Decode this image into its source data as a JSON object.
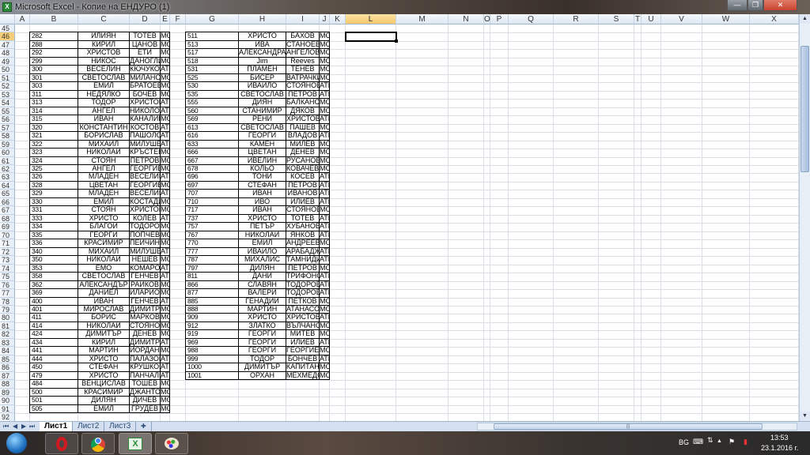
{
  "window": {
    "title": "Microsoft Excel - Копие на ЕНДУРО (1)",
    "minimize": "—",
    "restore": "❐",
    "close": "✕"
  },
  "columns": [
    "A",
    "B",
    "C",
    "D",
    "E",
    "F",
    "G",
    "H",
    "I",
    "J",
    "K",
    "L",
    "M",
    "N",
    "O",
    "P",
    "Q",
    "R",
    "S",
    "T",
    "U",
    "V",
    "W",
    "X"
  ],
  "selected_column": "L",
  "selected_row": "46",
  "rows": [
    "45",
    "46",
    "47",
    "48",
    "49",
    "50",
    "51",
    "52",
    "53",
    "54",
    "55",
    "56",
    "57",
    "58",
    "59",
    "60",
    "61",
    "62",
    "63",
    "64",
    "65",
    "66",
    "67",
    "68",
    "69",
    "70",
    "71",
    "72",
    "73",
    "74",
    "75",
    "76",
    "77",
    "78",
    "79",
    "80",
    "81",
    "82",
    "83",
    "84",
    "85",
    "86",
    "87",
    "88",
    "89",
    "90",
    "91",
    "92"
  ],
  "left_table": [
    [
      "282",
      "ИЛИЯН",
      "ТОТЕВ",
      "МОТОРИ"
    ],
    [
      "288",
      "КИРИЛ",
      "ЦАНОВ",
      "МОТОРИ"
    ],
    [
      "292",
      "ХРИСТОВ",
      "ЕТИ",
      "МОТОРИ"
    ],
    [
      "299",
      "НИКОС",
      "ДАНОГЛИДИС",
      "МОТОРИ"
    ],
    [
      "300",
      "ВЕСЕЛИН",
      "КЮЧУКОВ",
      "АТВ"
    ],
    [
      "301",
      "СВЕТОСЛАВ",
      "МИЛАНОВ",
      "МОТОРИ"
    ],
    [
      "303",
      "ЕМИЛ",
      "БРАТОЕВ",
      "МОТОРИ"
    ],
    [
      "311",
      "НЕДЯЛКО",
      "БОЧЕВ",
      "МОТОРИ"
    ],
    [
      "313",
      "ТОДОР",
      "ХРИСТОВ",
      "АТВ"
    ],
    [
      "314",
      "АНГЕЛ",
      "НИКОЛОВ",
      "АТВ"
    ],
    [
      "315",
      "ИВАН",
      "КАНАЛИЕВ",
      "МОТОРИ"
    ],
    [
      "320",
      "КОНСТАНТИН",
      "КОСТОВ",
      "АТВ"
    ],
    [
      "321",
      "БОРИСЛАВ",
      "ПАШОЛОВ",
      "АТВ"
    ],
    [
      "322",
      "МИХАИЛ",
      "МИЛУШЕВ",
      "АТВ"
    ],
    [
      "323",
      "НИКОЛАЙ",
      "КРЪСТЕВ",
      "МОТОРИ"
    ],
    [
      "324",
      "СТОЯН",
      "ПЕТРОВ",
      "МОТОРИ"
    ],
    [
      "325",
      "АНГЕЛ",
      "ГЕОРГИЕВ",
      "МОТОРИ"
    ],
    [
      "326",
      "МЛАДЕН",
      "ВЕСЕЛИНОВ",
      "АТВ"
    ],
    [
      "328",
      "ЦВЕТАН",
      "ГЕОРГИЕВ",
      "МОТОРИ"
    ],
    [
      "329",
      "МЛАДЕН",
      "ВЕСЕЛИНОВ",
      "АТВ"
    ],
    [
      "330",
      "ЕМИЛ",
      "КОСТАДИНОВ",
      "МОТОРИ"
    ],
    [
      "331",
      "СТОЯН",
      "ХРИСТОВ",
      "МОТОРИ"
    ],
    [
      "333",
      "ХРИСТО",
      "КОЛЕВ",
      "АТВ"
    ],
    [
      "334",
      "БЛАГОЙ",
      "ТОДОРОВ",
      "МОТОРИ"
    ],
    [
      "335",
      "ГЕОРГИ",
      "ПОПЧЕВ",
      "МОТОРИ"
    ],
    [
      "336",
      "КРАСИМИР",
      "ПЕЙЧИНОВ",
      "МОТОРИ"
    ],
    [
      "340",
      "МИХАИЛ",
      "МИЛУШЕВ",
      "АТВ"
    ],
    [
      "350",
      "НИКОЛАЙ",
      "НЕШЕВ",
      "МОТОРИ"
    ],
    [
      "353",
      "ЕМО",
      "КОМАРОВСКИ",
      "АТВ"
    ],
    [
      "358",
      "СВЕТОСЛАВ",
      "ГЕНЧЕВ",
      "АТВ"
    ],
    [
      "362",
      "АЛЕКСАНДЪР",
      "РАЙКОВ",
      "МОТОРИ"
    ],
    [
      "369",
      "ДАНИЕЛ",
      "ИЛАРИОНОВ",
      "МОТОРИ"
    ],
    [
      "400",
      "ИВАН",
      "ГЕНЧЕВ",
      "АТВ"
    ],
    [
      "401",
      "МИРОСЛАВ",
      "ДИМИТРОВ",
      "МОТОРИ"
    ],
    [
      "411",
      "БОРИС",
      "МАРКОВ",
      "МОТОРИ"
    ],
    [
      "414",
      "НИКОЛАЙ",
      "СТОЯНОВ",
      "МОТОРИ"
    ],
    [
      "424",
      "ДИМИТЪР",
      "ДЕНЕВ",
      "МОТОРИ"
    ],
    [
      "434",
      "КИРИЛ",
      "ДИМИТРОВ",
      "АТВ"
    ],
    [
      "441",
      "МАРТИН",
      "ЙОРДАНОВ",
      "МОТОРИ"
    ],
    [
      "444",
      "ХРИСТО",
      "ПАЛАЗОВ",
      "АТВ"
    ],
    [
      "450",
      "СТЕФАН",
      "КРУШКОВ",
      "АТВ"
    ],
    [
      "479",
      "ХРИСТО",
      "ПАНЧАЛИЕВ",
      "АТВ"
    ],
    [
      "484",
      "ВЕНЦИСЛАВ",
      "ТОШЕВ",
      "МОТОРИ"
    ],
    [
      "500",
      "КРАСИМИР",
      "ДЖАНТОВ",
      "МОТОРИ"
    ],
    [
      "501",
      "ДИЛЯН",
      "ДИЧЕВ",
      "МОТОРИ"
    ],
    [
      "505",
      "ЕМИЛ",
      "ГРУДЕВ",
      "МОТОРИ"
    ]
  ],
  "right_table": [
    [
      "511",
      "ХРИСТО",
      "БАХОВ",
      "МОТОРИ"
    ],
    [
      "513",
      "ИВА",
      "СТАНОЕВА",
      "МОТОРИ"
    ],
    [
      "517",
      "АЛЕКСАНДРА",
      "АНГЕЛОВА",
      "МОТОРИ"
    ],
    [
      "518",
      "Jim",
      "Reeves",
      "МОТОРИ"
    ],
    [
      "531",
      "ПЛАМЕН",
      "ТЕНЕВ",
      "МОТОРИ"
    ],
    [
      "525",
      "БИСЕР",
      "ВАТРАЧКИ",
      "МОТОРИ"
    ],
    [
      "530",
      "ИВАЙЛО",
      "СТОЯНОВ",
      "АТВ"
    ],
    [
      "535",
      "СВЕТОСЛАВ",
      "ПЕТРОВ",
      "АТВ"
    ],
    [
      "555",
      "ДИЯН",
      "БАЛКАНСКИ",
      "МОТОРИ"
    ],
    [
      "560",
      "СТАНИМИР",
      "ДЯКОВ",
      "МОТОРИ"
    ],
    [
      "569",
      "РЕНИ",
      "ХРИСТОВА",
      "АТВ"
    ],
    [
      "613",
      "СВЕТОСЛАВ",
      "ПАШЕВ",
      "МОТОРИ"
    ],
    [
      "616",
      "ГЕОРГИ",
      "ВЛАДОВ",
      "АТВ"
    ],
    [
      "633",
      "КАМЕН",
      "МИЛЕВ",
      "МОТОРИ"
    ],
    [
      "666",
      "ЦВЕТАН",
      "ДЕНЕВ",
      "МОТОРИ"
    ],
    [
      "667",
      "ИВЕЛИН",
      "РУСАНОВ",
      "МОТОРИ"
    ],
    [
      "678",
      "КОЛЬО",
      "КОВАЧЕВ",
      "МОТОРИ"
    ],
    [
      "696",
      "ТОНИ",
      "КОСЕВ",
      "АТВ"
    ],
    [
      "697",
      "СТЕФАН",
      "ПЕТРОВ",
      "АТВ"
    ],
    [
      "707",
      "ИВАН",
      "ИВАНОВ",
      "АТВ"
    ],
    [
      "710",
      "ИВО",
      "ИЛИЕВ",
      "АТВ"
    ],
    [
      "717",
      "ИВАН",
      "СТОЯНОВ",
      "МОТОРИ"
    ],
    [
      "737",
      "ХРИСТО",
      "ТОТЕВ",
      "АТВ"
    ],
    [
      "757",
      "ПЕТЪР",
      "ХУБАНОВ",
      "АТВ"
    ],
    [
      "767",
      "НИКОЛАЙ",
      "ЯНКОВ",
      "АТВ"
    ],
    [
      "770",
      "ЕМИЛ",
      "АНДРЕЕВ",
      "МОТОРИ"
    ],
    [
      "777",
      "ИВАЙЛО",
      "АРАБАДЖИЕВ",
      "АТВ"
    ],
    [
      "787",
      "МИХАЛИС",
      "ТАМНИДИС",
      "АТВ"
    ],
    [
      "797",
      "ДИЛЯН",
      "ПЕТРОВ",
      "МОТОРИ"
    ],
    [
      "811",
      "ДАНИ",
      "ТРИФОНОВ",
      "АТВ"
    ],
    [
      "866",
      "СЛАВЯН",
      "ТОДОРОВ",
      "АТВ"
    ],
    [
      "877",
      "ВАЛЕРИ",
      "ТОДОРОВ",
      "АТВ"
    ],
    [
      "885",
      "ГЕНАДИЙ",
      "ПЕТКОВ",
      "МОТОРИ"
    ],
    [
      "888",
      "МАРТИН",
      "АТАНАСОВ",
      "МОТОРИ"
    ],
    [
      "909",
      "ХРИСТО",
      "ХРИСТОВ",
      "АТВ"
    ],
    [
      "912",
      "ЗЛАТКО",
      "ВЪЛЧАНОВ",
      "МОТОРИ"
    ],
    [
      "919",
      "ГЕОРГИ",
      "МИТЕВ",
      "МОТОРИ"
    ],
    [
      "969",
      "ГЕОРГИ",
      "ИЛИЕВ",
      "АТВ"
    ],
    [
      "988",
      "ГЕОРГИ",
      "ГЕОРГИЕВ",
      "МОТОРИ"
    ],
    [
      "999",
      "ТОДОР",
      "БОНЧЕВ",
      "АТВ"
    ],
    [
      "1000",
      "ДИМИТЪР",
      "КАПИТАНОВ",
      "МОТОРИ"
    ],
    [
      "1001",
      "ОРХАН",
      "МЕХМЕДОВ",
      "МОТОРИ"
    ]
  ],
  "sheet_tabs": [
    "Лист1",
    "Лист2",
    "Лист3"
  ],
  "active_sheet": "Лист1",
  "tray": {
    "language": "BG",
    "time": "13:53",
    "date": "23.1.2016 г."
  },
  "taskbar_apps": [
    "opera",
    "chrome",
    "excel",
    "paint"
  ],
  "colors": {
    "header_selected": "#f6c86c",
    "close_button": "#c8432f"
  }
}
